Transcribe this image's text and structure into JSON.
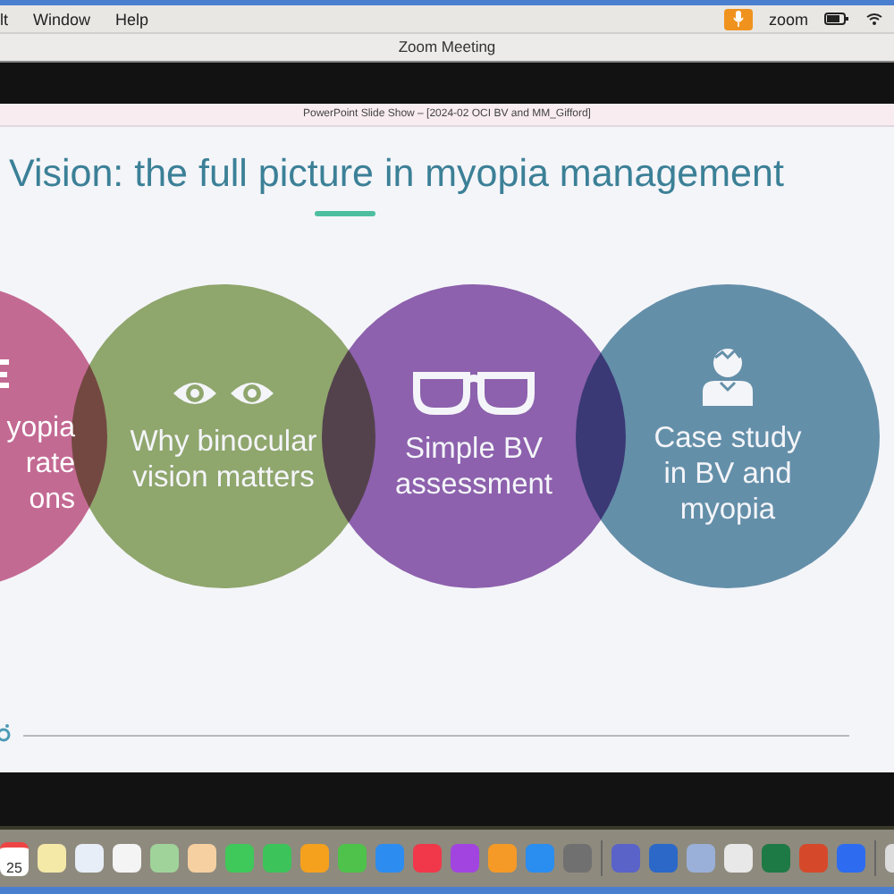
{
  "menu_bar": {
    "items": [
      "lt",
      "Window",
      "Help"
    ],
    "app_name": "zoom"
  },
  "window": {
    "title": "Zoom Meeting"
  },
  "slideshow": {
    "title": "PowerPoint Slide Show – [2024-02 OCI BV and MM_Gifford]"
  },
  "slide": {
    "title": "Vision: the full picture in myopia management",
    "circles": [
      {
        "kind": "cut",
        "color": "#c8618e",
        "lines": [
          "yopia",
          "rate",
          "ons"
        ]
      },
      {
        "kind": "eyes",
        "color": "#8da664",
        "lines": [
          "Why binocular",
          "vision matters"
        ]
      },
      {
        "kind": "glasses",
        "color": "#8a58ab",
        "lines": [
          "Simple BV",
          "assessment"
        ]
      },
      {
        "kind": "person",
        "color": "#5b8ca6",
        "lines": [
          "Case study",
          "in BV and",
          "myopia"
        ]
      }
    ]
  },
  "dock": {
    "calendar_day": "25"
  }
}
